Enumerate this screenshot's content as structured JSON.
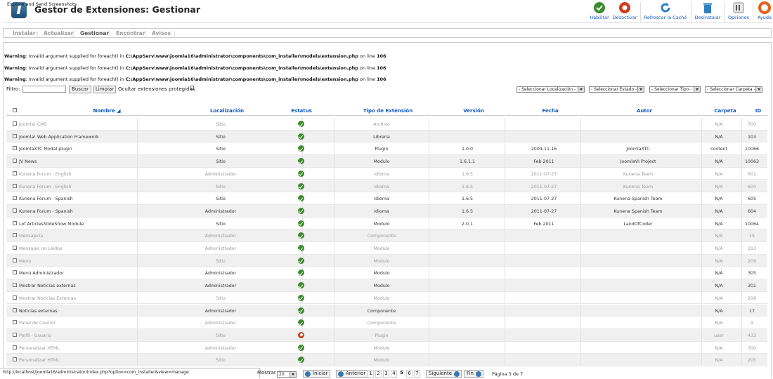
{
  "app": {
    "capture_label": "Explore and Send Screenshots",
    "title": "Gestor de Extensiones: Gestionar"
  },
  "toolbar": {
    "habilitar": "Habilitar",
    "desactivar": "Desactivar",
    "refrescar": "Refrescar la Caché",
    "desinstalar": "Desinstalar",
    "opciones": "Opciones",
    "ayuda": "Ayuda"
  },
  "subnav": {
    "instalar": "Instalar",
    "actualizar": "Actualizar",
    "gestionar": "Gestionar",
    "encontrar": "Encontrar",
    "avisos": "Avisos"
  },
  "warnings": [
    {
      "label": "Warning",
      "msg": ": Invalid argument supplied for foreach() in ",
      "path": "C:\\AppServ\\www\\joomla16\\administrator\\components\\com_installer\\models\\extension.php",
      "mid": " on line ",
      "line": "106"
    },
    {
      "label": "Warning",
      "msg": ": Invalid argument supplied for foreach() in ",
      "path": "C:\\AppServ\\www\\joomla16\\administrator\\components\\com_installer\\models\\extension.php",
      "mid": " on line ",
      "line": "106"
    },
    {
      "label": "Warning",
      "msg": ": Invalid argument supplied for foreach() in ",
      "path": "C:\\AppServ\\www\\joomla16\\administrator\\components\\com_installer\\models\\extension.php",
      "mid": " on line ",
      "line": "106"
    }
  ],
  "filter": {
    "label": "Filtro:",
    "value": "",
    "buscar": "Buscar",
    "limpiar": "Limpiar",
    "hide_protected": "Ocultar extensiones protegidas"
  },
  "selects": {
    "localizacion": "- Seleccionar Localización -",
    "estado": "- Seleccionar Estado -",
    "tipo": "- Seleccionar Tipo -",
    "carpeta": "- Seleccionar Carpeta -"
  },
  "columns": {
    "nombre": "Nombre",
    "localizacion": "Localización",
    "estatus": "Estatus",
    "tipo": "Tipo de Extensión",
    "version": "Versión",
    "fecha": "Fecha",
    "autor": "Autor",
    "carpeta": "Carpeta",
    "id": "ID"
  },
  "rows": [
    {
      "name": "Joomla! CMS",
      "loc": "Sitio",
      "status": "enabled",
      "type": "Archivo",
      "version": "",
      "date": "",
      "author": "",
      "folder": "N/A",
      "id": "700",
      "dim": true
    },
    {
      "name": "Joomla! Web Application Framework",
      "loc": "Sitio",
      "status": "enabled",
      "type": "Libreria",
      "version": "",
      "date": "",
      "author": "",
      "folder": "N/A",
      "id": "103",
      "dim": false
    },
    {
      "name": "JoomlaXTC Modal plugin",
      "loc": "Sitio",
      "status": "enabled",
      "type": "Plugin",
      "version": "1.0.0",
      "date": "2009-11-16",
      "author": "JoomlaXTC",
      "folder": "content",
      "id": "10066",
      "dim": false
    },
    {
      "name": "JV News",
      "loc": "Sitio",
      "status": "enabled",
      "type": "Modulo",
      "version": "1.6.1.1",
      "date": "Feb 2011",
      "author": "JoomlaVI Project",
      "folder": "N/A",
      "id": "10063",
      "dim": false
    },
    {
      "name": "Kunena Forum - English",
      "loc": "Administrador",
      "status": "enabled",
      "type": "Idioma",
      "version": "1.6.5",
      "date": "2011-07-27",
      "author": "Kunena Team",
      "folder": "N/A",
      "id": "601",
      "dim": true
    },
    {
      "name": "Kunena Forum - English",
      "loc": "Sitio",
      "status": "enabled",
      "type": "Idioma",
      "version": "1.6.5",
      "date": "2011-07-27",
      "author": "Kunena Team",
      "folder": "N/A",
      "id": "600",
      "dim": true
    },
    {
      "name": "Kunena Forum - Spanish",
      "loc": "Sitio",
      "status": "enabled",
      "type": "Idioma",
      "version": "1.6.5",
      "date": "2011-07-27",
      "author": "Kunena Spanish Team",
      "folder": "N/A",
      "id": "605",
      "dim": false
    },
    {
      "name": "Kunena Forum - Spanish",
      "loc": "Administrador",
      "status": "enabled",
      "type": "Idioma",
      "version": "1.6.5",
      "date": "2011-07-27",
      "author": "Kunena Spanish Team",
      "folder": "N/A",
      "id": "604",
      "dim": false
    },
    {
      "name": "Lof ArticlesSlideShow Module",
      "loc": "Sitio",
      "status": "enabled",
      "type": "Modulo",
      "version": "2.0.1",
      "date": "Feb 2011",
      "author": "LandOfCoder",
      "folder": "N/A",
      "id": "10064",
      "dim": false
    },
    {
      "name": "Mensajería",
      "loc": "Administrador",
      "status": "enabled",
      "type": "Componente",
      "version": "",
      "date": "",
      "author": "",
      "folder": "N/A",
      "id": "15",
      "dim": true
    },
    {
      "name": "Mensajes no Leídos",
      "loc": "Administrador",
      "status": "enabled",
      "type": "Modulo",
      "version": "",
      "date": "",
      "author": "",
      "folder": "N/A",
      "id": "313",
      "dim": true
    },
    {
      "name": "Menu",
      "loc": "Sitio",
      "status": "enabled",
      "type": "Modulo",
      "version": "",
      "date": "",
      "author": "",
      "folder": "N/A",
      "id": "209",
      "dim": true
    },
    {
      "name": "Menú Administrador",
      "loc": "Administrador",
      "status": "enabled",
      "type": "Modulo",
      "version": "",
      "date": "",
      "author": "",
      "folder": "N/A",
      "id": "305",
      "dim": false
    },
    {
      "name": "Mostrar Noticias externas",
      "loc": "Administrador",
      "status": "enabled",
      "type": "Modulo",
      "version": "",
      "date": "",
      "author": "",
      "folder": "N/A",
      "id": "301",
      "dim": false
    },
    {
      "name": "Mostrar Noticias Externas",
      "loc": "Sitio",
      "status": "enabled",
      "type": "Modulo",
      "version": "",
      "date": "",
      "author": "",
      "folder": "N/A",
      "id": "206",
      "dim": true
    },
    {
      "name": "Noticias externas",
      "loc": "Administrador",
      "status": "enabled",
      "type": "Componente",
      "version": "",
      "date": "",
      "author": "",
      "folder": "N/A",
      "id": "17",
      "dim": false
    },
    {
      "name": "Panel de Control",
      "loc": "Administrador",
      "status": "enabled",
      "type": "Componente",
      "version": "",
      "date": "",
      "author": "",
      "folder": "N/A",
      "id": "9",
      "dim": true
    },
    {
      "name": "Perfil - Usuario",
      "loc": "Sitio",
      "status": "disabled",
      "type": "Plugin",
      "version": "",
      "date": "",
      "author": "",
      "folder": "user",
      "id": "433",
      "dim": true
    },
    {
      "name": "Personalizar HTML",
      "loc": "Administrador",
      "status": "enabled",
      "type": "Modulo",
      "version": "",
      "date": "",
      "author": "",
      "folder": "N/A",
      "id": "300",
      "dim": true
    },
    {
      "name": "Personalizar HTML",
      "loc": "Sitio",
      "status": "enabled",
      "type": "Modulo",
      "version": "",
      "date": "",
      "author": "",
      "folder": "N/A",
      "id": "205",
      "dim": true
    }
  ],
  "statusbar": {
    "url": "http://localhost/joomla16/administrator/index.php?option=com_installer&view=manage"
  },
  "pagination": {
    "mostrar": "Mostrar #",
    "limit": "20",
    "iniciar": "Iniciar",
    "anterior": "Anterior",
    "pages": [
      "1",
      "2",
      "3",
      "4",
      "5",
      "6",
      "7"
    ],
    "current": "5",
    "siguiente": "Siguiente",
    "fin": "Fin",
    "info": "Página 5 de 7"
  },
  "colors": {
    "link": "#0b55c4",
    "enabled": "#3b8b2a",
    "disabled": "#c8451d"
  },
  "icons": {
    "status_enabled": "check-circle-icon",
    "status_disabled": "disabled-circle-icon"
  }
}
